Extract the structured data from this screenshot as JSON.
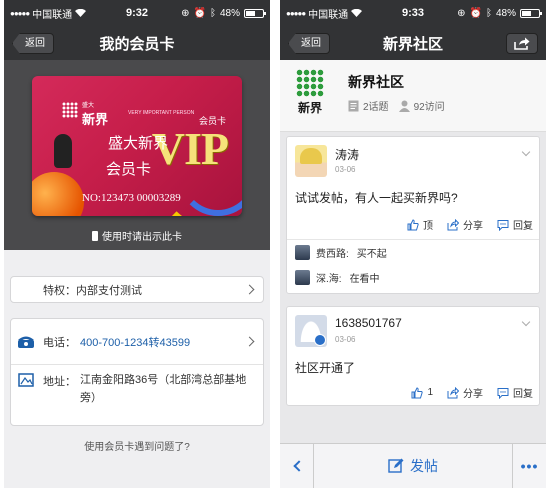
{
  "left": {
    "status": {
      "carrier": "中国联通",
      "time": "9:32",
      "battery": "48%",
      "battery_level": 0.48
    },
    "nav": {
      "back_label": "返回",
      "title": "我的会员卡"
    },
    "card": {
      "brand": "新界",
      "brand_small": "盛大",
      "tagline": "VERY IMPORTANT PERSON",
      "member_label": "会员卡",
      "vip": "VIP",
      "overlay_line1": "盛大新界",
      "overlay_line2": "会员卡",
      "card_number": "NO:123473 00003289"
    },
    "show_hint": "使用时请出示此卡",
    "privilege": {
      "label": "特权：",
      "value": "内部支付测试"
    },
    "contact": {
      "phone_label": "电话：",
      "phone": "400-700-1234转43599",
      "address_label": "地址：",
      "address": "江南金阳路36号（北部湾总部基地旁）"
    },
    "help_link": "使用会员卡遇到问题了?"
  },
  "right": {
    "status": {
      "carrier": "中国联通",
      "time": "9:33",
      "battery": "48%",
      "battery_level": 0.48
    },
    "nav": {
      "back_label": "返回",
      "title": "新界社区"
    },
    "community": {
      "logo_word": "新界",
      "name": "新界社区",
      "topics": "2话题",
      "visits": "92访问"
    },
    "posts": [
      {
        "user": "涛涛",
        "date": "03-06",
        "content": "试试发帖，有人一起买新界吗?",
        "actions": {
          "top": "顶",
          "share": "分享",
          "reply": "回复"
        },
        "replies": [
          {
            "name": "费西路:",
            "text": "买不起"
          },
          {
            "name": "深.海:",
            "text": "在看中"
          }
        ]
      },
      {
        "user": "1638501767",
        "date": "03-06",
        "content": "社区开通了",
        "actions": {
          "top": "1",
          "share": "分享",
          "reply": "回复"
        }
      }
    ],
    "bottom": {
      "post_label": "发帖"
    }
  },
  "colors": {
    "navbar": "#323335",
    "link_blue": "#1d5fa8",
    "accent_blue": "#2a6fc8",
    "card_red": "#c61e4a",
    "logo_green": "#2e9c3d"
  }
}
